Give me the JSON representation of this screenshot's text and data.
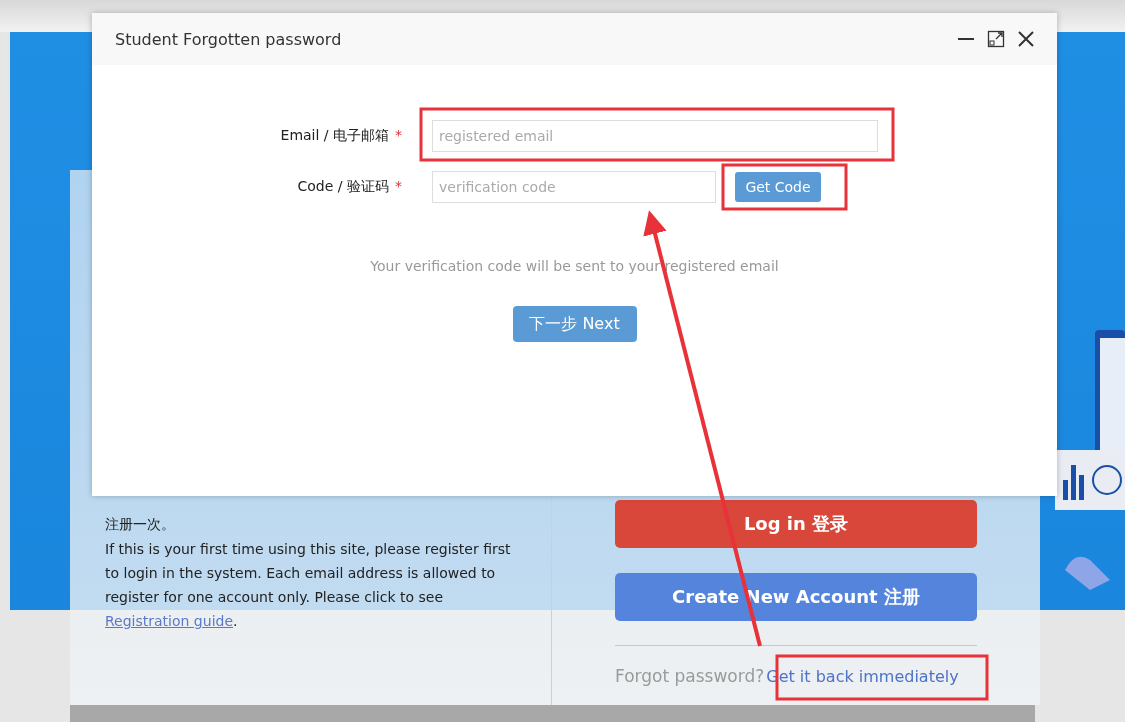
{
  "dialog": {
    "title": "Student Forgotten password",
    "fields": [
      {
        "label": "Email / 电子邮箱",
        "required_mark": "*",
        "placeholder": "registered email"
      },
      {
        "label": "Code / 验证码",
        "required_mark": "*",
        "placeholder": "verification code",
        "button": "Get Code"
      }
    ],
    "hint": "Your verification code will be sent to your registered email",
    "next_button": "下一步 Next"
  },
  "background_page": {
    "notice_cn": "注册一次。",
    "notice_en": "If this is your first time using this site, please register first to login in the system. Each email address is allowed to register for one account only. Please click to see",
    "guide_link": "Registration guide",
    "guide_end": ".",
    "login_button": "Log in 登录",
    "register_button": "Create New Account 注册",
    "forgot_label": "Forgot password?",
    "forgot_link": "Get it back immediately"
  }
}
